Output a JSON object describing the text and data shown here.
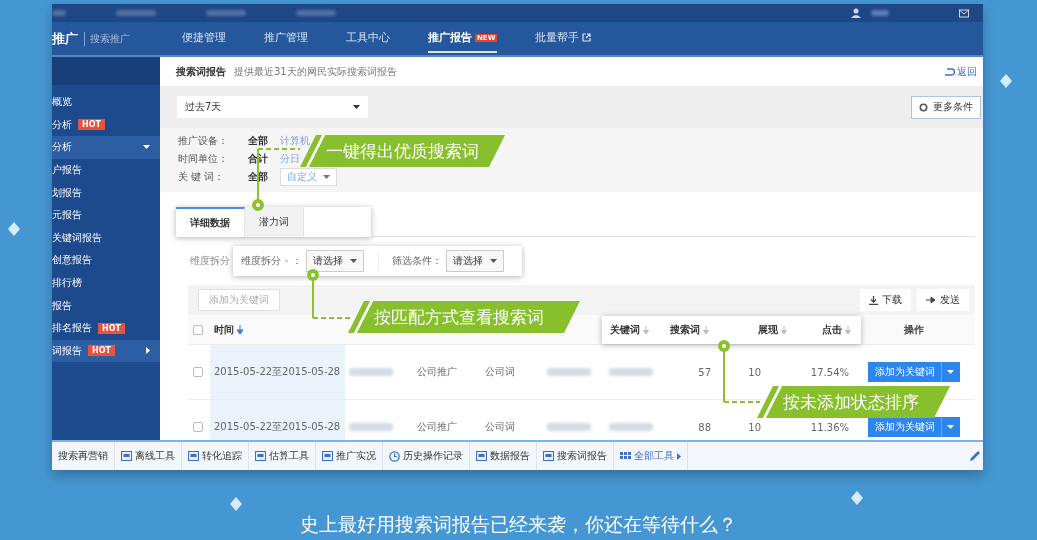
{
  "logo": {
    "brand": "推广",
    "product": "搜索推广"
  },
  "nav_tabs": [
    {
      "label": "便捷管理",
      "selected": false
    },
    {
      "label": "推广管理",
      "selected": false
    },
    {
      "label": "工具中心",
      "selected": false
    },
    {
      "label": "推广报告",
      "selected": true,
      "badge": "NEW"
    },
    {
      "label": "批量帮手",
      "selected": false,
      "external": true
    }
  ],
  "sidebar": {
    "items": [
      {
        "label": "概览",
        "selected": false,
        "kind": "link"
      },
      {
        "label": "分析",
        "badge": "HOT",
        "selected": false,
        "kind": "link"
      },
      {
        "label": "分析",
        "selected": true,
        "kind": "menu",
        "expanded": true
      },
      {
        "label": "户报告",
        "selected": false,
        "kind": "link"
      },
      {
        "label": "划报告",
        "selected": false,
        "kind": "link"
      },
      {
        "label": "元报告",
        "selected": false,
        "kind": "link"
      },
      {
        "label": "关键词报告",
        "selected": false,
        "kind": "link"
      },
      {
        "label": "创意报告",
        "selected": false,
        "kind": "link"
      },
      {
        "label": "排行榜",
        "selected": false,
        "kind": "link"
      },
      {
        "label": "报告",
        "selected": false,
        "kind": "link"
      },
      {
        "label": "排名报告",
        "badge": "HOT",
        "selected": false,
        "kind": "link"
      },
      {
        "label": "词报告",
        "badge": "HOT",
        "selected": true,
        "kind": "menu",
        "expanded": false
      }
    ]
  },
  "page_header": {
    "title": "搜索词报告",
    "description": "提供最近31天的网民实际搜索词报告",
    "back_link": "返回"
  },
  "date_range": {
    "value": "过去7天"
  },
  "more_button": {
    "label": "更多条件"
  },
  "filters": [
    {
      "label": "推广设备：",
      "options": [
        {
          "label": "全部",
          "selected": true
        },
        {
          "label": "计算机",
          "selected": false
        }
      ]
    },
    {
      "label": "时间单位：",
      "options": [
        {
          "label": "合计",
          "selected": true
        },
        {
          "label": "分日",
          "selected": false
        }
      ]
    },
    {
      "label": "关 键 词：",
      "options": [
        {
          "label": "全部",
          "selected": true
        },
        {
          "label": "自定义",
          "selected": false,
          "kind": "dropdown"
        }
      ]
    }
  ],
  "tabs": [
    {
      "label": "详细数据",
      "selected": true
    },
    {
      "label": "潜力词",
      "selected": false
    }
  ],
  "dimension_label": "维度拆分",
  "filter_popup": {
    "dimension": {
      "label": "维度拆分",
      "separator": "：",
      "select": "请选择"
    },
    "condition": {
      "label": "筛选条件：",
      "select": "请选择"
    }
  },
  "table": {
    "all_checked": false,
    "add_button": {
      "label": "添加为关键词",
      "disabled": true
    },
    "actions": [
      {
        "label": "下载",
        "kind": "download"
      },
      {
        "label": "发送",
        "kind": "send"
      }
    ],
    "columns": [
      {
        "label": "时间",
        "sorted": true
      },
      {
        "label": "操作",
        "sorted": false
      }
    ],
    "rows": [
      {
        "checked": false,
        "cells": [
          {
            "kind": "text",
            "text": "2015-05-22至2015-05-28"
          },
          {
            "kind": "blur"
          },
          {
            "kind": "text",
            "text": "公司推广"
          },
          {
            "kind": "text",
            "text": "公司词"
          },
          {
            "kind": "blur"
          },
          {
            "kind": "blur"
          },
          {
            "kind": "num",
            "text": "57"
          },
          {
            "kind": "num",
            "text": "10"
          },
          {
            "kind": "num",
            "text": "17.54%"
          },
          {
            "kind": "button",
            "text": "添加为关键词"
          }
        ]
      },
      {
        "checked": false,
        "cells": [
          {
            "kind": "text",
            "text": "2015-05-22至2015-05-28"
          },
          {
            "kind": "blur"
          },
          {
            "kind": "text",
            "text": "公司推广"
          },
          {
            "kind": "text",
            "text": "公司词"
          },
          {
            "kind": "blur"
          },
          {
            "kind": "blur"
          },
          {
            "kind": "num",
            "text": "88"
          },
          {
            "kind": "num",
            "text": "10"
          },
          {
            "kind": "num",
            "text": "11.36%"
          },
          {
            "kind": "button",
            "text": "添加为关键词"
          }
        ]
      }
    ]
  },
  "header_popup": [
    {
      "label": "关键词"
    },
    {
      "label": "搜索词"
    },
    {
      "label": "展现"
    },
    {
      "label": "点击"
    }
  ],
  "callouts": [
    {
      "text": "一键得出优质搜索词"
    },
    {
      "text": "按匹配方式查看搜索词"
    },
    {
      "text": "按未添加状态排序"
    }
  ],
  "toolbar": [
    {
      "label": "搜索再营销",
      "kind": "text"
    },
    {
      "label": "离线工具",
      "kind": "tool"
    },
    {
      "label": "转化追踪",
      "kind": "tool"
    },
    {
      "label": "估算工具",
      "kind": "tool"
    },
    {
      "label": "推广实况",
      "kind": "tool"
    },
    {
      "label": "历史操作记录",
      "kind": "history"
    },
    {
      "label": "数据报告",
      "kind": "tool"
    },
    {
      "label": "搜索词报告",
      "kind": "tool"
    },
    {
      "label": "全部工具",
      "kind": "all"
    }
  ],
  "tagline": "史上最好用搜索词报告已经来袭，你还在等待什么？"
}
